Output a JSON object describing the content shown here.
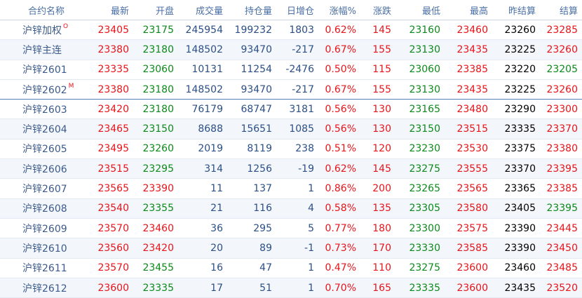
{
  "colors": {
    "up": "#e8141a",
    "down": "#0b8a1a",
    "flat": "#000000",
    "header": "#4a6fa5"
  },
  "headers": [
    "合约名称",
    "最新",
    "开盘",
    "成交量",
    "持仓量",
    "日增仓",
    "涨幅%",
    "涨跌",
    "最低",
    "最高",
    "昨结算",
    "结算"
  ],
  "rows": [
    {
      "name": "沪锌加权",
      "mark": "O",
      "latest": "23405",
      "open": "23175",
      "volume": "245954",
      "oi": "199232",
      "oi_chg": "1803",
      "pct": "0.62%",
      "chg": "145",
      "low": "23160",
      "high": "23460",
      "prev": "23260",
      "settle": "23285",
      "c": [
        "up",
        "down",
        "vol",
        "vol",
        "vol",
        "up",
        "up",
        "down",
        "up",
        "flat",
        "up"
      ]
    },
    {
      "name": "沪锌主连",
      "mark": "",
      "latest": "23380",
      "open": "23180",
      "volume": "148502",
      "oi": "93470",
      "oi_chg": "-217",
      "pct": "0.67%",
      "chg": "155",
      "low": "23130",
      "high": "23435",
      "prev": "23225",
      "settle": "23260",
      "c": [
        "up",
        "down",
        "vol",
        "vol",
        "vol",
        "up",
        "up",
        "down",
        "up",
        "flat",
        "up"
      ]
    },
    {
      "name": "沪锌2601",
      "mark": "",
      "latest": "23335",
      "open": "23060",
      "volume": "10131",
      "oi": "11254",
      "oi_chg": "-2476",
      "pct": "0.50%",
      "chg": "115",
      "low": "23060",
      "high": "23385",
      "prev": "23220",
      "settle": "23205",
      "c": [
        "up",
        "down",
        "vol",
        "vol",
        "vol",
        "up",
        "up",
        "down",
        "up",
        "flat",
        "down"
      ]
    },
    {
      "name": "沪锌2602",
      "mark": "M",
      "latest": "23380",
      "open": "23180",
      "volume": "148502",
      "oi": "93470",
      "oi_chg": "-217",
      "pct": "0.67%",
      "chg": "155",
      "low": "23130",
      "high": "23435",
      "prev": "23225",
      "settle": "23260",
      "c": [
        "up",
        "down",
        "vol",
        "vol",
        "vol",
        "up",
        "up",
        "down",
        "up",
        "flat",
        "up"
      ]
    },
    {
      "name": "沪锌2603",
      "mark": "",
      "latest": "23420",
      "open": "23180",
      "volume": "76179",
      "oi": "68747",
      "oi_chg": "3181",
      "pct": "0.56%",
      "chg": "130",
      "low": "23165",
      "high": "23480",
      "prev": "23290",
      "settle": "23300",
      "c": [
        "up",
        "down",
        "vol",
        "vol",
        "vol",
        "up",
        "up",
        "down",
        "up",
        "flat",
        "up"
      ]
    },
    {
      "name": "沪锌2604",
      "mark": "",
      "latest": "23465",
      "open": "23150",
      "volume": "8688",
      "oi": "15651",
      "oi_chg": "1085",
      "pct": "0.56%",
      "chg": "130",
      "low": "23150",
      "high": "23515",
      "prev": "23335",
      "settle": "23370",
      "c": [
        "up",
        "down",
        "vol",
        "vol",
        "vol",
        "up",
        "up",
        "down",
        "up",
        "flat",
        "up"
      ]
    },
    {
      "name": "沪锌2605",
      "mark": "",
      "latest": "23495",
      "open": "23260",
      "volume": "2019",
      "oi": "8119",
      "oi_chg": "238",
      "pct": "0.51%",
      "chg": "120",
      "low": "23230",
      "high": "23530",
      "prev": "23375",
      "settle": "23380",
      "c": [
        "up",
        "down",
        "vol",
        "vol",
        "vol",
        "up",
        "up",
        "down",
        "up",
        "flat",
        "up"
      ]
    },
    {
      "name": "沪锌2606",
      "mark": "",
      "latest": "23515",
      "open": "23295",
      "volume": "314",
      "oi": "1256",
      "oi_chg": "-19",
      "pct": "0.62%",
      "chg": "145",
      "low": "23275",
      "high": "23555",
      "prev": "23370",
      "settle": "23395",
      "c": [
        "up",
        "down",
        "vol",
        "vol",
        "vol",
        "up",
        "up",
        "down",
        "up",
        "flat",
        "up"
      ]
    },
    {
      "name": "沪锌2607",
      "mark": "",
      "latest": "23565",
      "open": "23390",
      "volume": "11",
      "oi": "137",
      "oi_chg": "1",
      "pct": "0.86%",
      "chg": "200",
      "low": "23265",
      "high": "23565",
      "prev": "23365",
      "settle": "23385",
      "c": [
        "up",
        "up",
        "vol",
        "vol",
        "vol",
        "up",
        "up",
        "down",
        "up",
        "flat",
        "up"
      ]
    },
    {
      "name": "沪锌2608",
      "mark": "",
      "latest": "23540",
      "open": "23355",
      "volume": "21",
      "oi": "116",
      "oi_chg": "4",
      "pct": "0.58%",
      "chg": "135",
      "low": "23305",
      "high": "23580",
      "prev": "23405",
      "settle": "23395",
      "c": [
        "up",
        "down",
        "vol",
        "vol",
        "vol",
        "up",
        "up",
        "down",
        "up",
        "flat",
        "down"
      ]
    },
    {
      "name": "沪锌2609",
      "mark": "",
      "latest": "23570",
      "open": "23460",
      "volume": "36",
      "oi": "295",
      "oi_chg": "5",
      "pct": "0.77%",
      "chg": "180",
      "low": "23300",
      "high": "23575",
      "prev": "23390",
      "settle": "23445",
      "c": [
        "up",
        "up",
        "vol",
        "vol",
        "vol",
        "up",
        "up",
        "down",
        "up",
        "flat",
        "up"
      ]
    },
    {
      "name": "沪锌2610",
      "mark": "",
      "latest": "23560",
      "open": "23420",
      "volume": "20",
      "oi": "89",
      "oi_chg": "-1",
      "pct": "0.73%",
      "chg": "170",
      "low": "23330",
      "high": "23585",
      "prev": "23390",
      "settle": "23450",
      "c": [
        "up",
        "up",
        "vol",
        "vol",
        "vol",
        "up",
        "up",
        "down",
        "up",
        "flat",
        "up"
      ]
    },
    {
      "name": "沪锌2611",
      "mark": "",
      "latest": "23570",
      "open": "23455",
      "volume": "16",
      "oi": "47",
      "oi_chg": "1",
      "pct": "0.47%",
      "chg": "110",
      "low": "23275",
      "high": "23600",
      "prev": "23460",
      "settle": "23485",
      "c": [
        "up",
        "down",
        "vol",
        "vol",
        "vol",
        "up",
        "up",
        "down",
        "up",
        "flat",
        "up"
      ]
    },
    {
      "name": "沪锌2612",
      "mark": "",
      "latest": "23600",
      "open": "23335",
      "volume": "17",
      "oi": "51",
      "oi_chg": "1",
      "pct": "0.70%",
      "chg": "165",
      "low": "23335",
      "high": "23600",
      "prev": "23435",
      "settle": "23520",
      "c": [
        "up",
        "down",
        "vol",
        "vol",
        "vol",
        "up",
        "up",
        "down",
        "up",
        "flat",
        "up"
      ]
    }
  ]
}
